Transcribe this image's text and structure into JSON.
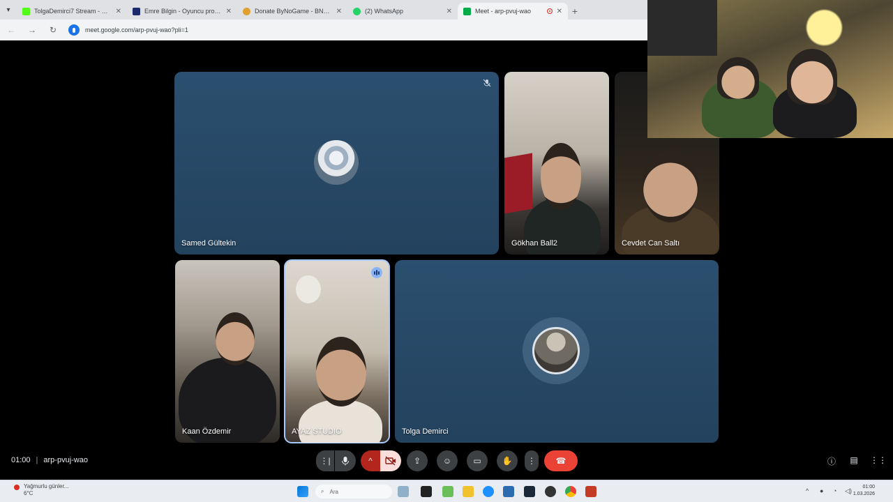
{
  "browser": {
    "tabs": [
      {
        "title": "TolgaDemirci7 Stream - Watch",
        "favicon_color": "#53fc18"
      },
      {
        "title": "Emre Bilgin - Oyuncu profili 25",
        "favicon_color": "#1b2a6b"
      },
      {
        "title": "Donate ByNoGame - BNG Stre",
        "favicon_color": "#e0a030"
      },
      {
        "title": "(2) WhatsApp",
        "favicon_color": "#25d366"
      },
      {
        "title": "Meet - arp-pvuj-wao",
        "favicon_color": "#00ac47",
        "active": true
      }
    ],
    "url": "meet.google.com/arp-pvuj-wao?pli=1"
  },
  "meet": {
    "participants": [
      {
        "name": "Samed Gültekin",
        "muted": true
      },
      {
        "name": "Gökhan Ball2"
      },
      {
        "name": "Cevdet Can Saltı"
      },
      {
        "name": "Kaan Özdemir"
      },
      {
        "name": "AYAZ STUDIO",
        "speaking": true
      },
      {
        "name": "Tolga Demirci"
      }
    ],
    "time": "01:00",
    "separator": "|",
    "meeting_code": "arp-pvuj-wao",
    "accent": "#a8c7fa",
    "end_call_color": "#ea4335"
  },
  "taskbar": {
    "weather_title": "Yağmurlu günler...",
    "weather_temp": "6°C",
    "search_placeholder": "Ara",
    "time": "01:00",
    "date": "1.03.2026"
  }
}
